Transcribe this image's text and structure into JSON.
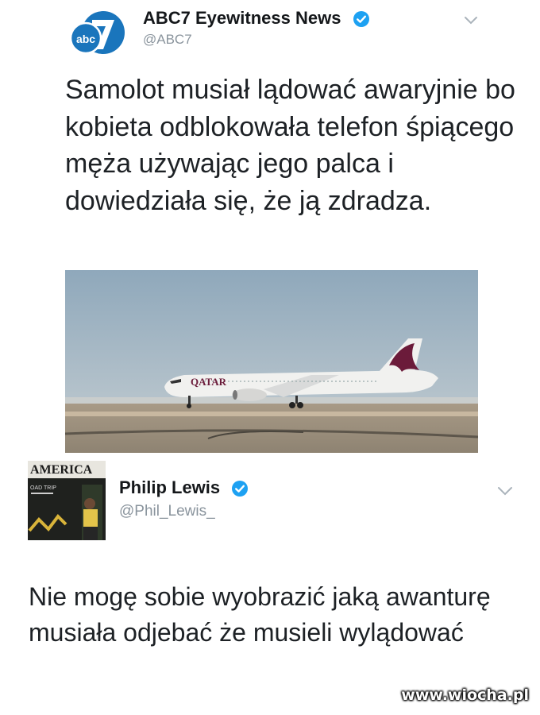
{
  "quoted_tweet": {
    "author_name": "ABC7 Eyewitness News",
    "author_handle": "@ABC7",
    "avatar_logo_text": "abc 7",
    "verified_icon": "verified-badge-icon",
    "menu_icon": "chevron-down-icon",
    "text": "Samolot musiał lądować awaryjnie bo kobieta odblokowała telefon śpiącego męża używając jego palca i dowiedziała się, że ją zdradza.",
    "image": {
      "subject": "airplane-photo",
      "livery_text": "QATAR"
    }
  },
  "reply_tweet": {
    "author_name": "Philip Lewis",
    "author_handle": "@Phil_Lewis_",
    "avatar_text": "AMERICA",
    "avatar_subtext": "OAD TRIP",
    "verified_icon": "verified-badge-icon",
    "menu_icon": "chevron-down-icon",
    "text": "Nie mogę sobie wyobrazić jaką awanturę musiała odjebać że musieli wylądować"
  },
  "watermark": "www.wiocha.pl",
  "colors": {
    "verified_blue": "#1da1f2",
    "abc_blue": "#1a75bc",
    "handle_gray": "#8a949d"
  }
}
